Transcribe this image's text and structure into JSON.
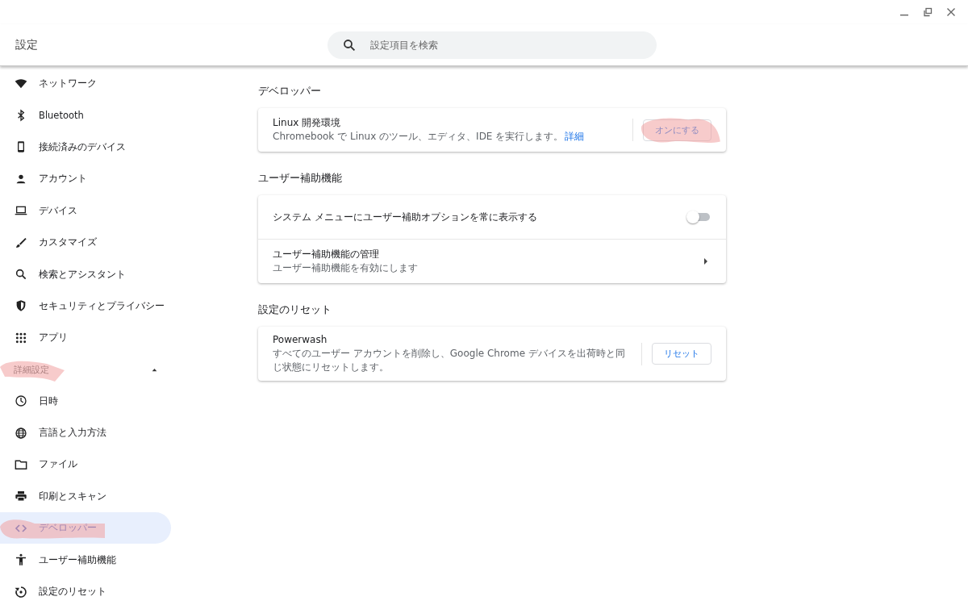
{
  "window": {
    "title": "設定"
  },
  "search": {
    "placeholder": "設定項目を検索"
  },
  "sidebar": {
    "items": [
      {
        "label": "ネットワーク",
        "selected": false
      },
      {
        "label": "Bluetooth",
        "selected": false
      },
      {
        "label": "接続済みのデバイス",
        "selected": false
      },
      {
        "label": "アカウント",
        "selected": false
      },
      {
        "label": "デバイス",
        "selected": false
      },
      {
        "label": "カスタマイズ",
        "selected": false
      },
      {
        "label": "検索とアシスタント",
        "selected": false
      },
      {
        "label": "セキュリティとプライバシー",
        "selected": false
      },
      {
        "label": "アプリ",
        "selected": false
      }
    ],
    "advanced": {
      "label": "詳細設定",
      "expanded": true,
      "children": [
        {
          "label": "日時",
          "selected": false
        },
        {
          "label": "言語と入力方法",
          "selected": false
        },
        {
          "label": "ファイル",
          "selected": false
        },
        {
          "label": "印刷とスキャン",
          "selected": false
        },
        {
          "label": "デベロッパー",
          "selected": true
        },
        {
          "label": "ユーザー補助機能",
          "selected": false
        },
        {
          "label": "設定のリセット",
          "selected": false
        }
      ]
    }
  },
  "sections": [
    {
      "title": "デベロッパー",
      "rows": [
        {
          "kind": "button",
          "title": "Linux 開発環境",
          "description": "Chromebook で Linux のツール、エディタ、IDE を実行します。",
          "link": "詳細",
          "button": "オンにする"
        }
      ]
    },
    {
      "title": "ユーザー補助機能",
      "rows": [
        {
          "kind": "toggle",
          "title": "システム メニューにユーザー補助オプションを常に表示する",
          "on": false
        },
        {
          "kind": "link",
          "title": "ユーザー補助機能の管理",
          "description": "ユーザー補助機能を有効にします"
        }
      ]
    },
    {
      "title": "設定のリセット",
      "rows": [
        {
          "kind": "button",
          "title": "Powerwash",
          "description": "すべてのユーザー アカウントを削除し、Google Chrome デバイスを出荷時と同じ状態にリセットします。",
          "button": "リセット"
        }
      ]
    }
  ]
}
